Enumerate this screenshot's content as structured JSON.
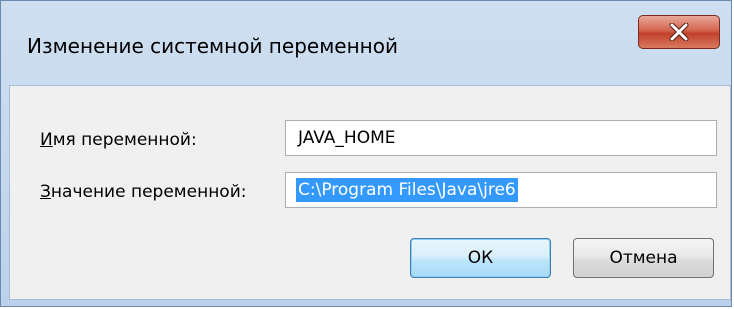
{
  "window": {
    "title": "Изменение системной переменной",
    "close_icon": "close-x-icon"
  },
  "form": {
    "name_label_accel": "И",
    "name_label_rest": "мя переменной:",
    "name_value": "JAVA_HOME",
    "value_label_accel": "З",
    "value_label_rest": "начение переменной:",
    "value_value": "C:\\Program Files\\Java\\jre6"
  },
  "buttons": {
    "ok": "ОК",
    "cancel": "Отмена"
  },
  "colors": {
    "selection": "#3399ff",
    "close_button": "#c1412b",
    "frame": "#bcd2ec"
  }
}
